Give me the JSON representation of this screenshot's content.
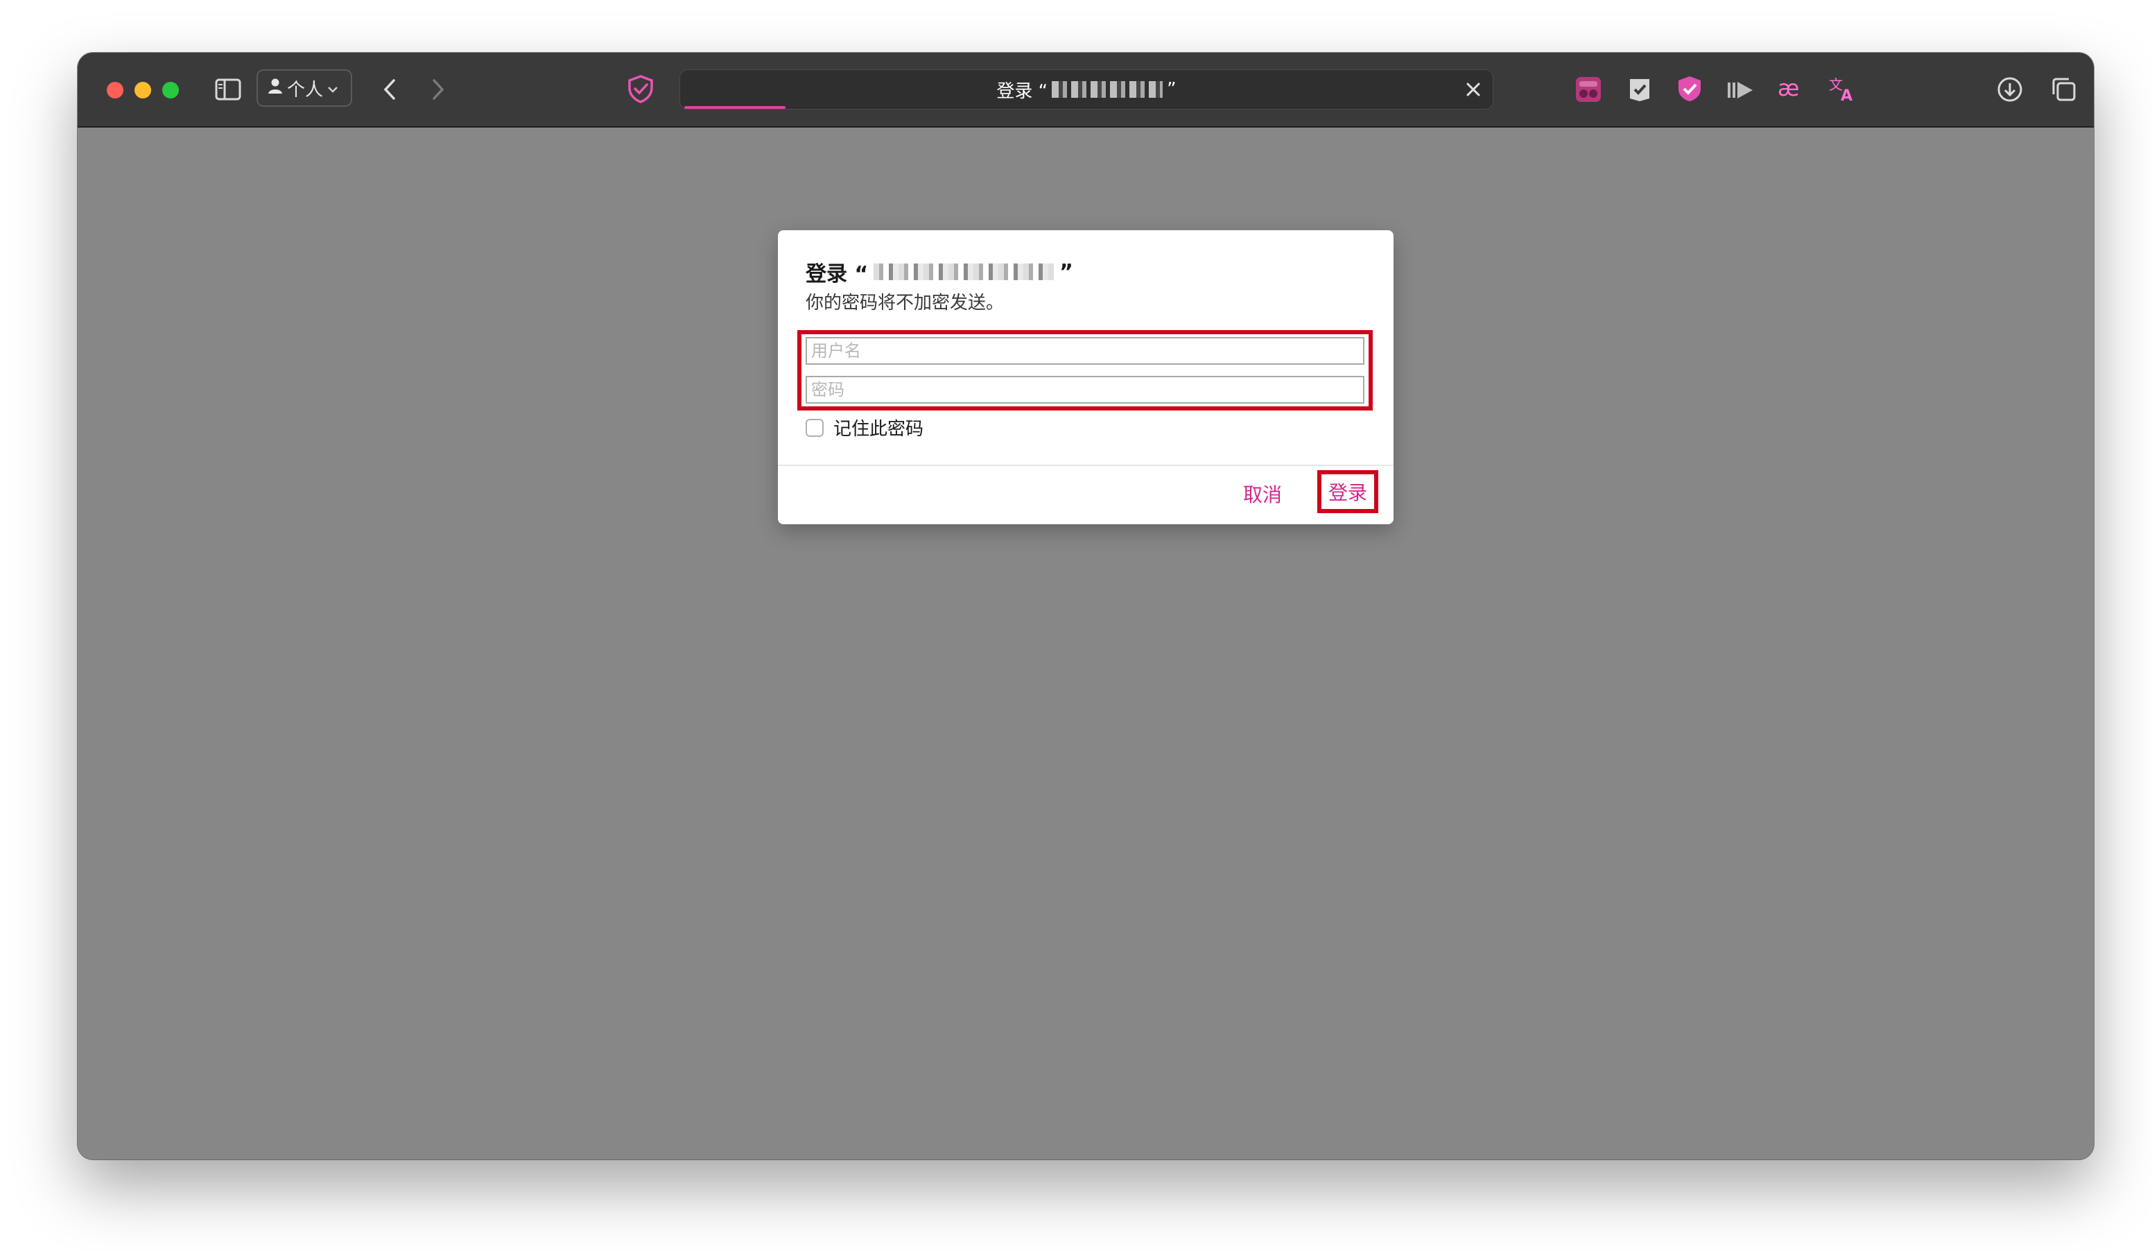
{
  "browser": {
    "profile_label": "个人",
    "tab_title_prefix": "登录 “",
    "tab_title_suffix": "”"
  },
  "toolbar_icons": [
    "sidebar-icon",
    "person-icon",
    "chevron-down-icon",
    "back-icon",
    "forward-icon",
    "shield-check-icon",
    "close-icon",
    "extension-icon",
    "bookmark-shield-icon",
    "privacy-badge-icon",
    "play-icon",
    "ae-icon",
    "translate-icon",
    "download-icon",
    "tabs-overview-icon",
    "plus-icon"
  ],
  "dialog": {
    "title_prefix": "登录 “",
    "title_suffix": "”",
    "subtitle": "你的密码将不加密发送。",
    "username_placeholder": "用户名",
    "password_placeholder": "密码",
    "remember_label": "记住此密码",
    "cancel_label": "取消",
    "login_label": "登录"
  },
  "colors": {
    "accent": "#d6258c",
    "highlight": "#d0021b",
    "page_bg": "#878787",
    "toolbar_bg": "#3a3a3a"
  }
}
